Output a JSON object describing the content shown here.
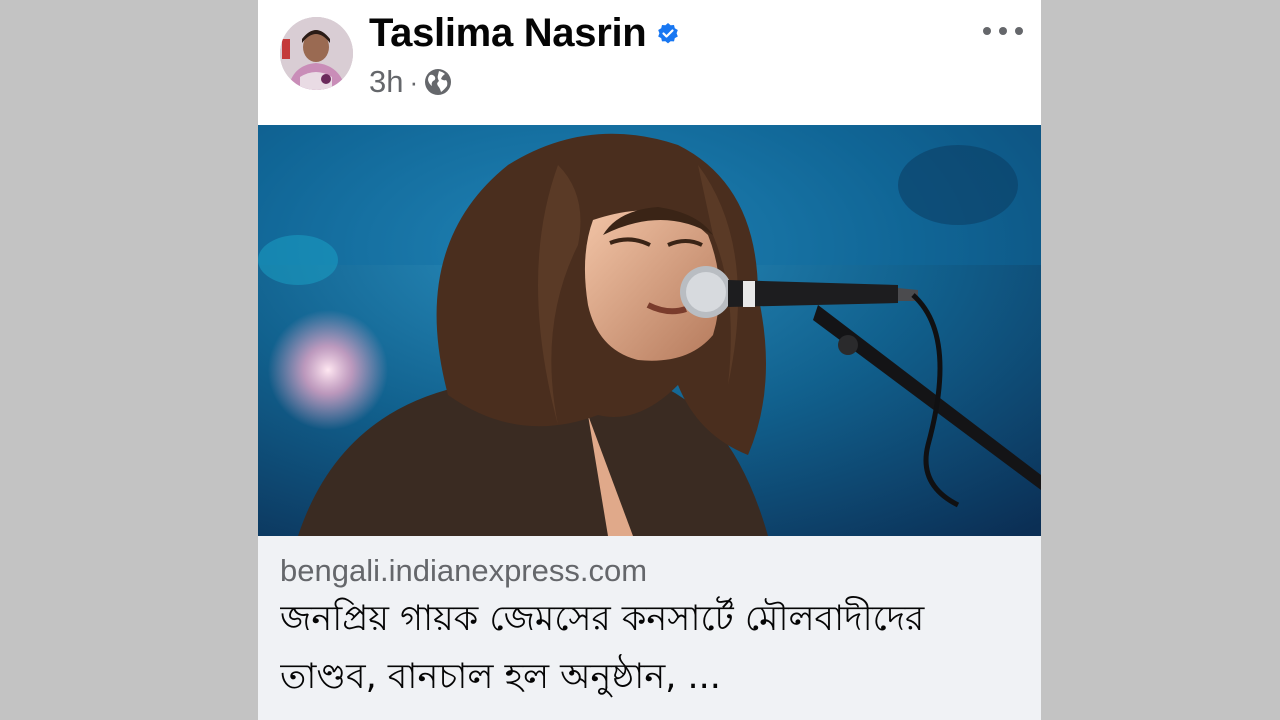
{
  "post": {
    "author": {
      "name": "Taslima Nasrin",
      "verified": true,
      "avatar_icon": "profile-photo"
    },
    "time": "3h",
    "separator": "·",
    "audience_icon": "globe-icon",
    "more_icon": "more-options-icon",
    "image": {
      "description_icon": "singer-photo",
      "accent_colors": [
        "#0d6f9c",
        "#1a3c6e",
        "#3a2b22"
      ]
    },
    "link": {
      "domain": "bengali.indianexpress.com",
      "title": "জনপ্রিয় গায়ক জেমসের কনসার্টে মৌলবাদীদের তাণ্ডব, বানচাল হল অনুষ্ঠান, ..."
    }
  },
  "colors": {
    "background": "#c3c3c3",
    "card": "#ffffff",
    "verified": "#1877f2",
    "secondary_text": "#65676b",
    "preview_bg": "#f0f2f5"
  }
}
